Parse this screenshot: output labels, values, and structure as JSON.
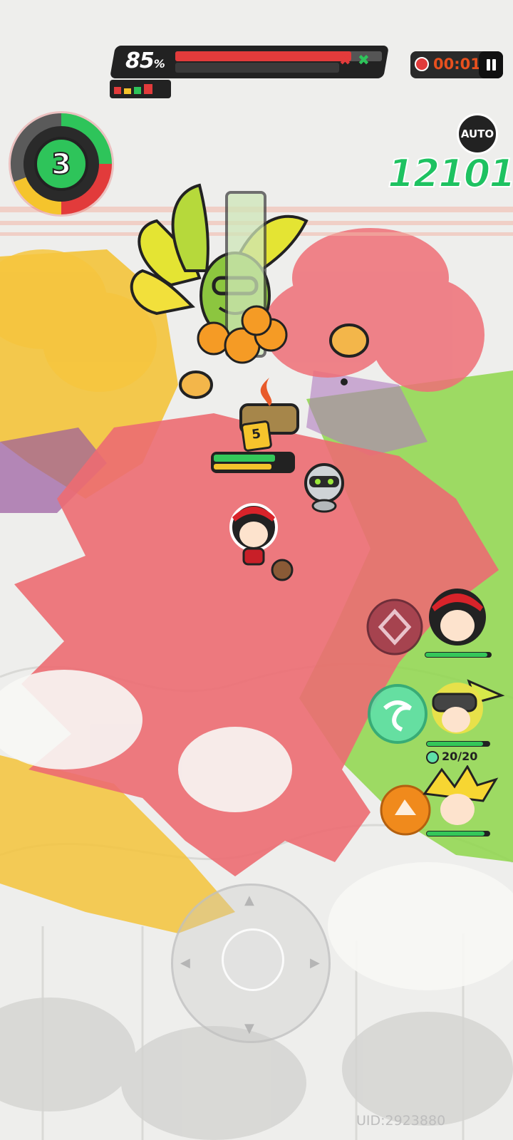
{
  "boss": {
    "hp_percent_label": "85",
    "hp_percent_sign": "%",
    "hp_fraction": 0.85,
    "color_hp": "#e23b3b"
  },
  "timer": {
    "value": "00:01",
    "icon": "clock-icon",
    "color": "#e8501e"
  },
  "pause": {
    "icon": "pause-icon"
  },
  "auto_button": {
    "label": "AUTO"
  },
  "combo": {
    "value": "12101",
    "color": "#1ec261"
  },
  "wave": {
    "number": "3"
  },
  "boss_enemy": {
    "level": "5",
    "hp_fraction": 0.78,
    "shield_fraction": 0.74
  },
  "party": [
    {
      "name": "hero-1",
      "hp_fraction": 0.95
    },
    {
      "name": "hero-2",
      "hp_fraction": 0.9,
      "skill_count": "20/20"
    },
    {
      "name": "hero-3",
      "hp_fraction": 0.92
    }
  ],
  "uid": "UID:2923880",
  "colors": {
    "background": "#eeeeec",
    "arena_red": "#ec6b72",
    "arena_green": "#8ed64b",
    "arena_yellow": "#f3c33b",
    "hp_green": "#34c759"
  }
}
